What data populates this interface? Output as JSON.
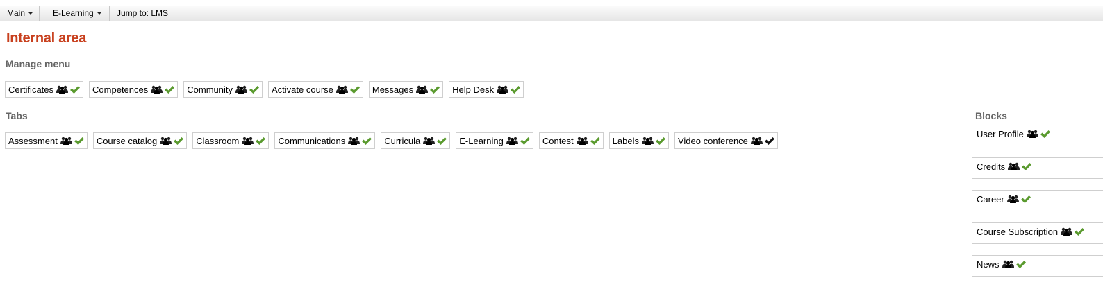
{
  "topbar": {
    "menus": [
      {
        "label": "Main"
      },
      {
        "label": "E-Learning"
      },
      {
        "label": "Jump to: LMS"
      }
    ]
  },
  "page_title": "Internal area",
  "manage_menu": {
    "title": "Manage menu",
    "items": [
      {
        "label": "Certificates",
        "check": "green"
      },
      {
        "label": "Competences",
        "check": "green"
      },
      {
        "label": "Community",
        "check": "green"
      },
      {
        "label": "Activate course",
        "check": "green"
      },
      {
        "label": "Messages",
        "check": "green"
      },
      {
        "label": "Help Desk",
        "check": "green"
      }
    ]
  },
  "tabs": {
    "title": "Tabs",
    "items": [
      {
        "label": "Assessment",
        "check": "green"
      },
      {
        "label": "Course catalog",
        "check": "green"
      },
      {
        "label": "Classroom",
        "check": "green"
      },
      {
        "label": "Communications",
        "check": "green"
      },
      {
        "label": "Curricula",
        "check": "green"
      },
      {
        "label": "E-Learning",
        "check": "green"
      },
      {
        "label": "Contest",
        "check": "green"
      },
      {
        "label": "Labels",
        "check": "green"
      },
      {
        "label": "Video conference",
        "check": "black"
      }
    ]
  },
  "blocks": {
    "title": "Blocks",
    "items": [
      {
        "label": "User Profile",
        "check": "green"
      },
      {
        "label": "Credits",
        "check": "green"
      },
      {
        "label": "Career",
        "check": "green"
      },
      {
        "label": "Course Subscription",
        "check": "green"
      },
      {
        "label": "News",
        "check": "green"
      }
    ]
  },
  "icons": {
    "group": "user-group-icon",
    "check": "checkmark-icon"
  },
  "colors": {
    "title": "#c8401e",
    "section": "#666666",
    "check_green": "#5a9a2e",
    "check_black": "#111111"
  }
}
